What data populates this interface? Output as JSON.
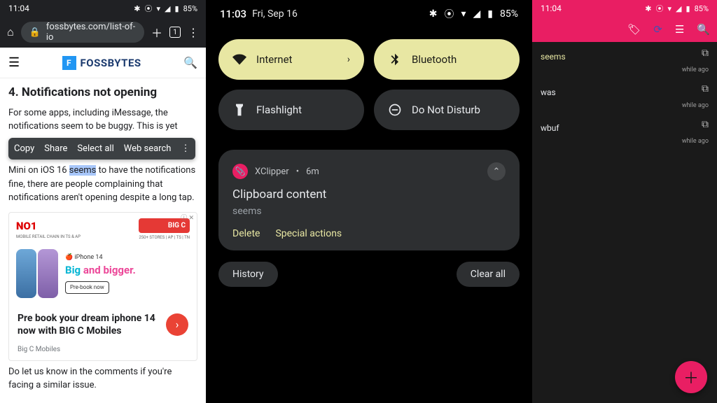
{
  "phone1": {
    "status": {
      "time": "11:04",
      "battery": "85%"
    },
    "browser": {
      "url": "fossbytes.com/list-of-io"
    },
    "site": {
      "brand": "FOSSBYTES"
    },
    "article": {
      "heading": "4. Notifications not opening",
      "p1_a": "For some apps, including iMessage, the notifications seem to be buggy. This is yet",
      "ctx": {
        "copy": "Copy",
        "share": "Share",
        "select_all": "Select all",
        "web_search": "Web search"
      },
      "p2_a": "Mini on iOS 16 ",
      "p2_hl": "seems",
      "p2_b": " to have the notifications fine, there are people complaining that notifications aren't opening despite a long tap.",
      "footer": "Do let us know in the comments if you're facing a similar issue."
    },
    "ad": {
      "no1": "NO1",
      "no1_sub": "MOBILE RETAIL CHAIN IN TS & AP",
      "badge": "BIG C",
      "badge_sub": "250+ STORES | AP | TS | TN",
      "iphone_label": "iPhone 14",
      "big_bigger_a": "Big ",
      "big_bigger_b": "and bigger.",
      "prebook": "Pre-book now",
      "headline": "Pre book your dream iphone 14 now with BIG C Mobiles",
      "source": "Big C Mobiles"
    }
  },
  "phone2": {
    "status": {
      "time": "11:03",
      "date": "Fri, Sep 16",
      "battery": "85%"
    },
    "qs": {
      "internet": "Internet",
      "bluetooth": "Bluetooth",
      "flashlight": "Flashlight",
      "dnd": "Do Not Disturb"
    },
    "notif": {
      "app": "XClipper",
      "age": "6m",
      "title": "Clipboard content",
      "body": "seems",
      "delete": "Delete",
      "special": "Special actions"
    },
    "footer": {
      "history": "History",
      "clear_all": "Clear all"
    }
  },
  "phone3": {
    "status": {
      "time": "11:04",
      "battery": "85%"
    },
    "items": [
      {
        "label": "seems",
        "time": "while ago",
        "accent": true
      },
      {
        "label": "was",
        "time": "while ago",
        "accent": false
      },
      {
        "label": "wbuf",
        "time": "while ago",
        "accent": false
      }
    ]
  }
}
